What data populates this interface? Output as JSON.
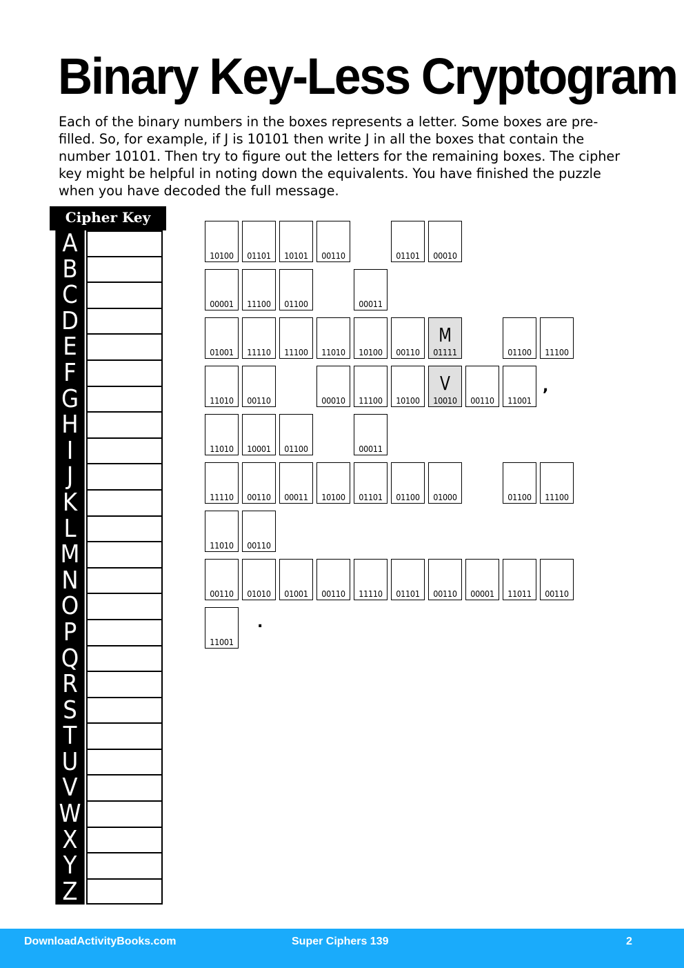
{
  "title": "Binary Key-Less Cryptogram",
  "intro": "Each of the binary numbers in the boxes represents a letter. Some boxes are pre-filled. So, for example, if J is 10101 then write J in all the boxes that contain the number 10101. Then try to figure out the letters for the remaining boxes. The cipher key might be helpful in noting down the equivalents. You have finished the puzzle when you have decoded the full message.",
  "cipher_key": {
    "header": "Cipher Key",
    "letters": [
      "A",
      "B",
      "C",
      "D",
      "E",
      "F",
      "G",
      "H",
      "I",
      "J",
      "K",
      "L",
      "M",
      "N",
      "O",
      "P",
      "Q",
      "R",
      "S",
      "T",
      "U",
      "V",
      "W",
      "X",
      "Y",
      "Z"
    ]
  },
  "puzzle": {
    "rows": [
      [
        {
          "col": 0,
          "code": "10100"
        },
        {
          "col": 1,
          "code": "01101"
        },
        {
          "col": 2,
          "code": "10101"
        },
        {
          "col": 3,
          "code": "00110"
        },
        {
          "col": 5,
          "code": "01101"
        },
        {
          "col": 6,
          "code": "00010"
        }
      ],
      [
        {
          "col": 0,
          "code": "00001"
        },
        {
          "col": 1,
          "code": "11100"
        },
        {
          "col": 2,
          "code": "01100"
        },
        {
          "col": 4,
          "code": "00011"
        }
      ],
      [
        {
          "col": 0,
          "code": "01001"
        },
        {
          "col": 1,
          "code": "11110"
        },
        {
          "col": 2,
          "code": "11100"
        },
        {
          "col": 3,
          "code": "11010"
        },
        {
          "col": 4,
          "code": "10100"
        },
        {
          "col": 5,
          "code": "00110"
        },
        {
          "col": 6,
          "code": "01111",
          "letter": "M"
        },
        {
          "col": 8,
          "code": "01100"
        },
        {
          "col": 9,
          "code": "11100"
        }
      ],
      [
        {
          "col": 0,
          "code": "11010"
        },
        {
          "col": 1,
          "code": "00110"
        },
        {
          "col": 3,
          "code": "00010"
        },
        {
          "col": 4,
          "code": "11100"
        },
        {
          "col": 5,
          "code": "10100"
        },
        {
          "col": 6,
          "code": "10010",
          "letter": "V"
        },
        {
          "col": 7,
          "code": "00110"
        },
        {
          "col": 8,
          "code": "11001"
        },
        {
          "col": 9,
          "punct": ","
        }
      ],
      [
        {
          "col": 0,
          "code": "11010"
        },
        {
          "col": 1,
          "code": "10001"
        },
        {
          "col": 2,
          "code": "01100"
        },
        {
          "col": 4,
          "code": "00011"
        }
      ],
      [
        {
          "col": 0,
          "code": "11110"
        },
        {
          "col": 1,
          "code": "00110"
        },
        {
          "col": 2,
          "code": "00011"
        },
        {
          "col": 3,
          "code": "10100"
        },
        {
          "col": 4,
          "code": "01101"
        },
        {
          "col": 5,
          "code": "01100"
        },
        {
          "col": 6,
          "code": "01000"
        },
        {
          "col": 8,
          "code": "01100"
        },
        {
          "col": 9,
          "code": "11100"
        }
      ],
      [
        {
          "col": 0,
          "code": "11010"
        },
        {
          "col": 1,
          "code": "00110"
        }
      ],
      [
        {
          "col": 0,
          "code": "00110"
        },
        {
          "col": 1,
          "code": "01010"
        },
        {
          "col": 2,
          "code": "01001"
        },
        {
          "col": 3,
          "code": "00110"
        },
        {
          "col": 4,
          "code": "11110"
        },
        {
          "col": 5,
          "code": "01101"
        },
        {
          "col": 6,
          "code": "00110"
        },
        {
          "col": 7,
          "code": "00001"
        },
        {
          "col": 8,
          "code": "11011"
        },
        {
          "col": 9,
          "code": "00110"
        }
      ],
      [
        {
          "col": 0,
          "code": "11001"
        },
        {
          "col": 1,
          "punct": "."
        }
      ]
    ]
  },
  "footer": {
    "site": "DownloadActivityBooks.com",
    "book": "Super Ciphers 139",
    "page": "2"
  },
  "colors": {
    "footer_bg": "#1aabfb",
    "prefilled_bg": "#e0e0e0"
  }
}
